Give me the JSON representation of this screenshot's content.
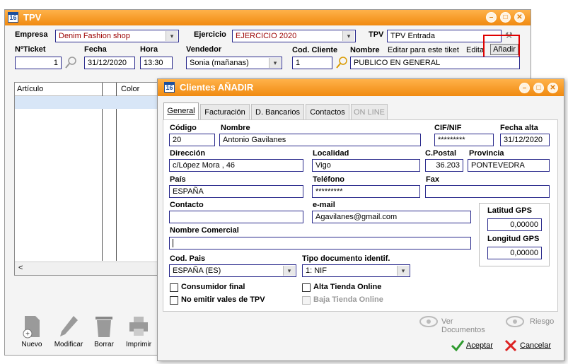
{
  "tpv_window": {
    "title": "TPV",
    "icon_label": "16",
    "labels": {
      "empresa": "Empresa",
      "ejercicio": "Ejercicio",
      "tpv": "TPV",
      "nticket": "NºTicket",
      "fecha": "Fecha",
      "hora": "Hora",
      "vendedor": "Vendedor",
      "cod_cliente": "Cod. Cliente",
      "nombre": "Nombre"
    },
    "empresa_value": "Denim Fashion shop",
    "ejercicio_value": "EJERCICIO 2020",
    "tpv_value": "TPV Entrada",
    "nticket_value": "1",
    "fecha_value": "31/12/2020",
    "hora_value": "13:30",
    "vendedor_value": "Sonia (mañanas)",
    "cod_cliente_value": "1",
    "nombre_value": "PUBLICO EN GENERAL",
    "editar_tiket": "Editar para este tiket",
    "editar_short": "Edita",
    "anadir_button": "Añadir",
    "grid_columns": [
      "Artículo",
      "Color"
    ],
    "toolbar": [
      {
        "label": "Nuevo",
        "icon": "new-document-icon"
      },
      {
        "label": "Modificar",
        "icon": "pencil-icon"
      },
      {
        "label": "Borrar",
        "icon": "trash-icon"
      },
      {
        "label": "Imprimir",
        "icon": "printer-icon"
      }
    ]
  },
  "clientes_dialog": {
    "title": "Clientes AÑADIR",
    "icon_label": "16",
    "tabs": [
      {
        "label": "General",
        "state": "active"
      },
      {
        "label": "Facturación",
        "state": "normal"
      },
      {
        "label": "D. Bancarios",
        "state": "normal"
      },
      {
        "label": "Contactos",
        "state": "normal"
      },
      {
        "label": "ON LINE",
        "state": "disabled"
      }
    ],
    "fields": {
      "codigo": {
        "label": "Código",
        "value": "20"
      },
      "nombre": {
        "label": "Nombre",
        "value": "Antonio Gavilanes"
      },
      "cif": {
        "label": "CIF/NIF",
        "value": "*********"
      },
      "fecha_alta": {
        "label": "Fecha alta",
        "value": "31/12/2020"
      },
      "direccion": {
        "label": "Dirección",
        "value": "c/López Mora , 46"
      },
      "localidad": {
        "label": "Localidad",
        "value": "Vigo"
      },
      "cpostal": {
        "label": "C.Postal",
        "value": "36.203"
      },
      "provincia": {
        "label": "Provincia",
        "value": "PONTEVEDRA"
      },
      "pais": {
        "label": "País",
        "value": "ESPAÑA"
      },
      "telefono": {
        "label": "Teléfono",
        "value": "*********"
      },
      "fax": {
        "label": "Fax",
        "value": ""
      },
      "contacto": {
        "label": "Contacto",
        "value": ""
      },
      "email": {
        "label": "e-mail",
        "value": "Agavilanes@gmail.com"
      },
      "nombre_comercial": {
        "label": "Nombre Comercial",
        "value": ""
      },
      "cod_pais": {
        "label": "Cod. Pais",
        "value": "ESPAÑA  (ES)"
      },
      "tipo_doc": {
        "label": "Tipo documento identif.",
        "value": "1: NIF"
      },
      "latitud": {
        "label": "Latitud GPS",
        "value": "0,00000"
      },
      "longitud": {
        "label": "Longitud GPS",
        "value": "0,00000"
      }
    },
    "checkboxes": {
      "consumidor_final": "Consumidor final",
      "no_emitir_vales": "No emitir vales de TPV",
      "alta_tienda": "Alta Tienda Online",
      "baja_tienda": "Baja Tienda Online"
    },
    "ver_documentos": "Ver Documentos",
    "riesgo": "Riesgo",
    "aceptar": "Aceptar",
    "cancelar": "Cancelar"
  },
  "colors": {
    "titlebar": "#f08a10",
    "field_border": "#2a2a8c",
    "highlight_box": "#e00000",
    "red_text": "#9b0000"
  }
}
